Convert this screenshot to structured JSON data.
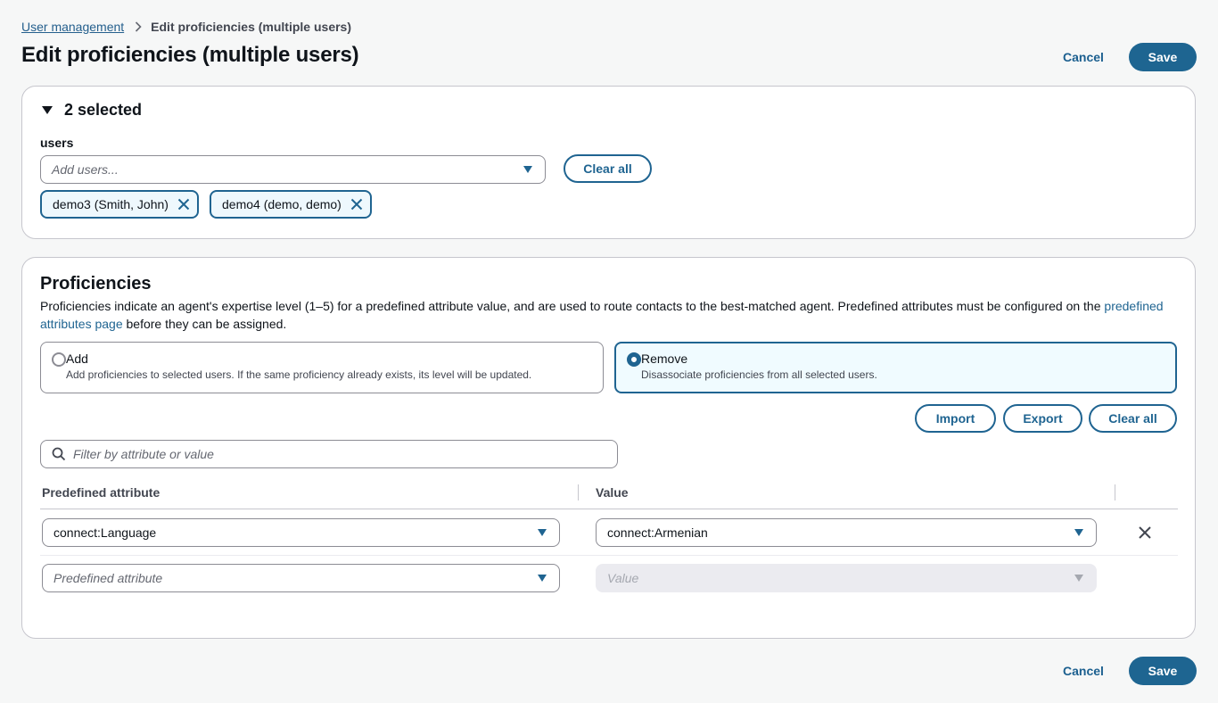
{
  "breadcrumb": {
    "parent": "User management",
    "current": "Edit proficiencies (multiple users)"
  },
  "header": {
    "title": "Edit proficiencies (multiple users)",
    "cancel_label": "Cancel",
    "save_label": "Save"
  },
  "selection": {
    "heading": "2 selected",
    "users_label": "users",
    "users_placeholder": "Add users...",
    "clear_all_label": "Clear all",
    "tokens": [
      {
        "label": "demo3 (Smith, John)"
      },
      {
        "label": "demo4 (demo, demo)"
      }
    ]
  },
  "proficiencies": {
    "heading": "Proficiencies",
    "description_before": "Proficiencies indicate an agent's expertise level (1–5) for a predefined attribute value, and are used to route contacts to the best-matched agent. Predefined attributes must be configured on the ",
    "description_link": "predefined attributes page",
    "description_after": " before they can be assigned.",
    "mode_options": [
      {
        "label": "Add",
        "description": "Add proficiencies to selected users. If the same proficiency already exists, its level will be updated.",
        "selected": false
      },
      {
        "label": "Remove",
        "description": "Disassociate proficiencies from all selected users.",
        "selected": true
      }
    ],
    "import_label": "Import",
    "export_label": "Export",
    "clear_all_label": "Clear all",
    "filter_placeholder": "Filter by attribute or value",
    "columns": {
      "attribute": "Predefined attribute",
      "value": "Value"
    },
    "rows": [
      {
        "attribute": "connect:Language",
        "value": "connect:Armenian"
      }
    ],
    "new_row": {
      "attribute_placeholder": "Predefined attribute",
      "value_placeholder": "Value"
    }
  },
  "footer": {
    "cancel_label": "Cancel",
    "save_label": "Save"
  },
  "colors": {
    "primary": "#1f6491",
    "selected_tile_bg": "#f0fbff",
    "page_bg": "#f6f7f7"
  }
}
